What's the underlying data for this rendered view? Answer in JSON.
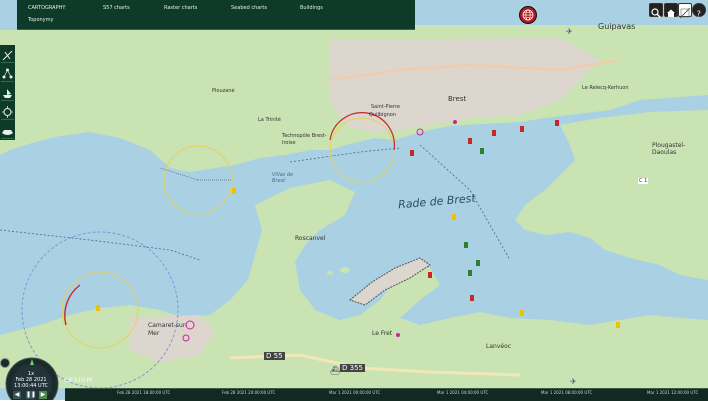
{
  "menu": {
    "cartography": "CARTOGRAPHY",
    "s57": "S57 charts",
    "raster": "Raster charts",
    "seabed": "Seabed charts",
    "buildings": "Buildings",
    "toponymy": "Toponymy"
  },
  "map_labels": {
    "guipavas": "Guipavas",
    "brest": "Brest",
    "relecq": "Le Relecq-Kerhuon",
    "plougastel": "Plougastel-Daoulas",
    "rade": "Rade de Brest",
    "roscanvel": "Roscanvel",
    "camaret": "Camaret-sur-Mer",
    "lefret": "Le Fret",
    "lanveoc": "Lanvéoc",
    "technopole": "Technopôle Brest-Iroise",
    "plouzane": "Plouzané",
    "latrinite": "La Trinité",
    "saintpierre": "Saint-Pierre",
    "quilbignon": "Quilbignon",
    "d55": "D 55",
    "d355": "D 355",
    "c1": "C 1",
    "vilasdebrest": "Villas de Brest"
  },
  "clock": {
    "speed": "1x",
    "date": "Feb 28 2021",
    "time": "13:00:44 UTC"
  },
  "brand": "CESIUM",
  "timeline": {
    "ticks": [
      "Feb 28 2021 18:00:00 UTC",
      "Feb 28 2021 20:00:00 UTC",
      "Mar 1 2021 00:00:00 UTC",
      "Mar 1 2021 04:00:00 UTC",
      "Mar 1 2021 08:00:00 UTC",
      "Mar 1 2021 12:00:00 UTC"
    ]
  },
  "colors": {
    "sea": "#a9d1e3",
    "land": "#c9e3b3",
    "urban": "#dcd6cf",
    "panel": "#0e3a2a",
    "accent": "#b3171d"
  },
  "icons": {
    "search": "search-icon",
    "home": "home-icon",
    "layers": "layers-icon",
    "help": "help-icon",
    "globe": "globe-icon"
  }
}
